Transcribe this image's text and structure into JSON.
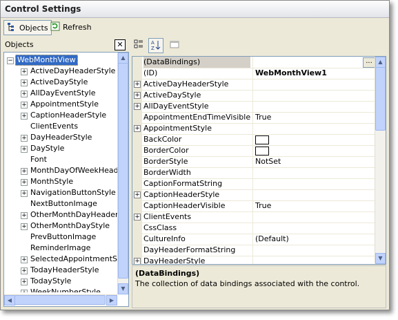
{
  "window": {
    "title": "Control Settings"
  },
  "toolbar": {
    "objects_label": "Objects",
    "refresh_label": "Refresh"
  },
  "objects_panel": {
    "label": "Objects",
    "close_glyph": "✕",
    "root": "WebMonthView",
    "items": [
      {
        "label": "ActiveDayHeaderStyle",
        "expandable": true
      },
      {
        "label": "ActiveDayStyle",
        "expandable": true
      },
      {
        "label": "AllDayEventStyle",
        "expandable": true
      },
      {
        "label": "AppointmentStyle",
        "expandable": true
      },
      {
        "label": "CaptionHeaderStyle",
        "expandable": true
      },
      {
        "label": "ClientEvents",
        "expandable": false
      },
      {
        "label": "DayHeaderStyle",
        "expandable": true
      },
      {
        "label": "DayStyle",
        "expandable": true
      },
      {
        "label": "Font",
        "expandable": false
      },
      {
        "label": "MonthDayOfWeekHeader",
        "expandable": true
      },
      {
        "label": "MonthStyle",
        "expandable": true
      },
      {
        "label": "NavigationButtonStyle",
        "expandable": true
      },
      {
        "label": "NextButtonImage",
        "expandable": false
      },
      {
        "label": "OtherMonthDayHeaderSty",
        "expandable": true
      },
      {
        "label": "OtherMonthDayStyle",
        "expandable": true
      },
      {
        "label": "PrevButtonImage",
        "expandable": false
      },
      {
        "label": "ReminderImage",
        "expandable": false
      },
      {
        "label": "SelectedAppointmentStyle",
        "expandable": true
      },
      {
        "label": "TodayHeaderStyle",
        "expandable": true
      },
      {
        "label": "TodayStyle",
        "expandable": true
      },
      {
        "label": "WeekNumberStyle",
        "expandable": true
      }
    ]
  },
  "properties": [
    {
      "name": "(DataBindings)",
      "value": "",
      "expandable": false,
      "ellipsis": true,
      "selected": true
    },
    {
      "name": "(ID)",
      "value": "WebMonthView1",
      "expandable": false,
      "bold": true
    },
    {
      "name": "ActiveDayHeaderStyle",
      "value": "",
      "expandable": true
    },
    {
      "name": "ActiveDayStyle",
      "value": "",
      "expandable": true
    },
    {
      "name": "AllDayEventStyle",
      "value": "",
      "expandable": true
    },
    {
      "name": "AppointmentEndTimeVisible",
      "value": "True",
      "expandable": false
    },
    {
      "name": "AppointmentStyle",
      "value": "",
      "expandable": true
    },
    {
      "name": "BackColor",
      "value": "",
      "expandable": false,
      "swatch": true
    },
    {
      "name": "BorderColor",
      "value": "",
      "expandable": false,
      "swatch": true
    },
    {
      "name": "BorderStyle",
      "value": "NotSet",
      "expandable": false
    },
    {
      "name": "BorderWidth",
      "value": "",
      "expandable": false
    },
    {
      "name": "CaptionFormatString",
      "value": "",
      "expandable": false
    },
    {
      "name": "CaptionHeaderStyle",
      "value": "",
      "expandable": true
    },
    {
      "name": "CaptionHeaderVisible",
      "value": "True",
      "expandable": false
    },
    {
      "name": "ClientEvents",
      "value": "",
      "expandable": true
    },
    {
      "name": "CssClass",
      "value": "",
      "expandable": false
    },
    {
      "name": "CultureInfo",
      "value": "(Default)",
      "expandable": false
    },
    {
      "name": "DayHeaderFormatString",
      "value": "",
      "expandable": false
    },
    {
      "name": "DayHeaderStyle",
      "value": "",
      "expandable": true
    }
  ],
  "description": {
    "title": "(DataBindings)",
    "text": "The collection of data bindings associated with the control."
  }
}
